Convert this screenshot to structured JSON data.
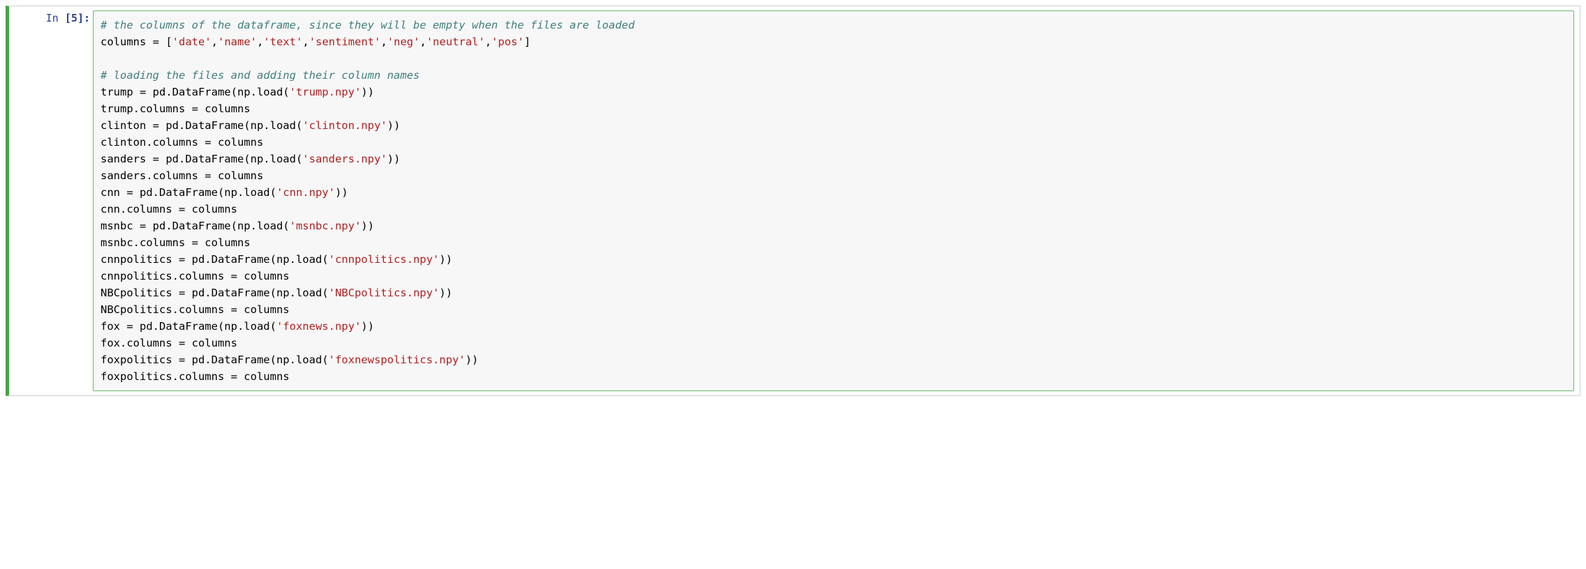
{
  "cell": {
    "prompt": {
      "label": "In ",
      "open_bracket": "[",
      "number": "5",
      "close_bracket": "]:"
    },
    "code": {
      "tokens": [
        {
          "type": "comment",
          "text": "# the columns of the dataframe, since they will be empty when the files are loaded"
        },
        {
          "type": "nl"
        },
        {
          "type": "plain",
          "text": "columns = ["
        },
        {
          "type": "string",
          "text": "'date'"
        },
        {
          "type": "plain",
          "text": ","
        },
        {
          "type": "string",
          "text": "'name'"
        },
        {
          "type": "plain",
          "text": ","
        },
        {
          "type": "string",
          "text": "'text'"
        },
        {
          "type": "plain",
          "text": ","
        },
        {
          "type": "string",
          "text": "'sentiment'"
        },
        {
          "type": "plain",
          "text": ","
        },
        {
          "type": "string",
          "text": "'neg'"
        },
        {
          "type": "plain",
          "text": ","
        },
        {
          "type": "string",
          "text": "'neutral'"
        },
        {
          "type": "plain",
          "text": ","
        },
        {
          "type": "string",
          "text": "'pos'"
        },
        {
          "type": "plain",
          "text": "]"
        },
        {
          "type": "nl"
        },
        {
          "type": "nl"
        },
        {
          "type": "comment",
          "text": "# loading the files and adding their column names"
        },
        {
          "type": "nl"
        },
        {
          "type": "plain",
          "text": "trump = pd.DataFrame(np.load("
        },
        {
          "type": "string",
          "text": "'trump.npy'"
        },
        {
          "type": "plain",
          "text": "))"
        },
        {
          "type": "nl"
        },
        {
          "type": "plain",
          "text": "trump.columns = columns"
        },
        {
          "type": "nl"
        },
        {
          "type": "plain",
          "text": "clinton = pd.DataFrame(np.load("
        },
        {
          "type": "string",
          "text": "'clinton.npy'"
        },
        {
          "type": "plain",
          "text": "))"
        },
        {
          "type": "nl"
        },
        {
          "type": "plain",
          "text": "clinton.columns = columns"
        },
        {
          "type": "nl"
        },
        {
          "type": "plain",
          "text": "sanders = pd.DataFrame(np.load("
        },
        {
          "type": "string",
          "text": "'sanders.npy'"
        },
        {
          "type": "plain",
          "text": "))"
        },
        {
          "type": "nl"
        },
        {
          "type": "plain",
          "text": "sanders.columns = columns"
        },
        {
          "type": "nl"
        },
        {
          "type": "plain",
          "text": "cnn = pd.DataFrame(np.load("
        },
        {
          "type": "string",
          "text": "'cnn.npy'"
        },
        {
          "type": "plain",
          "text": "))"
        },
        {
          "type": "nl"
        },
        {
          "type": "plain",
          "text": "cnn.columns = columns"
        },
        {
          "type": "nl"
        },
        {
          "type": "plain",
          "text": "msnbc = pd.DataFrame(np.load("
        },
        {
          "type": "string",
          "text": "'msnbc.npy'"
        },
        {
          "type": "plain",
          "text": "))"
        },
        {
          "type": "nl"
        },
        {
          "type": "plain",
          "text": "msnbc.columns = columns"
        },
        {
          "type": "nl"
        },
        {
          "type": "plain",
          "text": "cnnpolitics = pd.DataFrame(np.load("
        },
        {
          "type": "string",
          "text": "'cnnpolitics.npy'"
        },
        {
          "type": "plain",
          "text": "))"
        },
        {
          "type": "nl"
        },
        {
          "type": "plain",
          "text": "cnnpolitics.columns = columns"
        },
        {
          "type": "nl"
        },
        {
          "type": "plain",
          "text": "NBCpolitics = pd.DataFrame(np.load("
        },
        {
          "type": "string",
          "text": "'NBCpolitics.npy'"
        },
        {
          "type": "plain",
          "text": "))"
        },
        {
          "type": "nl"
        },
        {
          "type": "plain",
          "text": "NBCpolitics.columns = columns"
        },
        {
          "type": "nl"
        },
        {
          "type": "plain",
          "text": "fox = pd.DataFrame(np.load("
        },
        {
          "type": "string",
          "text": "'foxnews.npy'"
        },
        {
          "type": "plain",
          "text": "))"
        },
        {
          "type": "nl"
        },
        {
          "type": "plain",
          "text": "fox.columns = columns"
        },
        {
          "type": "nl"
        },
        {
          "type": "plain",
          "text": "foxpolitics = pd.DataFrame(np.load("
        },
        {
          "type": "string",
          "text": "'foxnewspolitics.npy'"
        },
        {
          "type": "plain",
          "text": "))"
        },
        {
          "type": "nl"
        },
        {
          "type": "plain",
          "text": "foxpolitics.columns = columns"
        }
      ]
    }
  }
}
